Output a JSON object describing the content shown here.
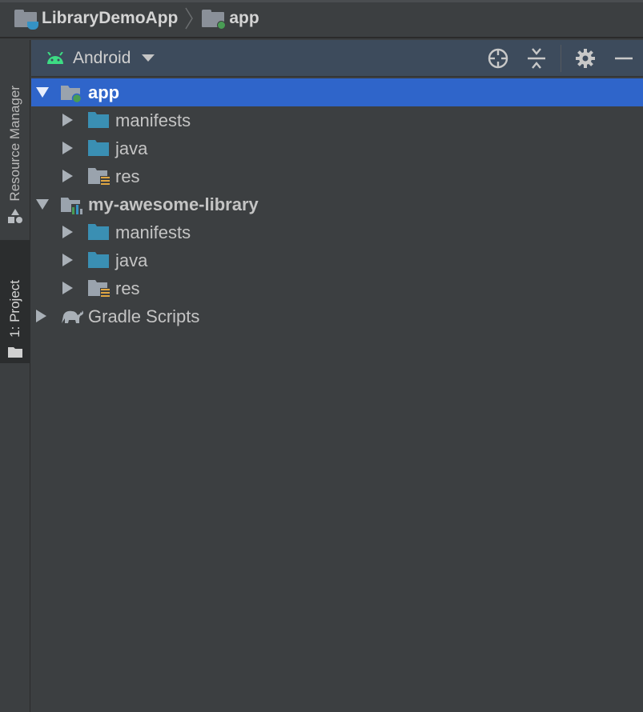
{
  "breadcrumb": {
    "project": "LibraryDemoApp",
    "module": "app"
  },
  "side_tabs": {
    "resource_manager": "Resource Manager",
    "project": "1: Project"
  },
  "tool_window": {
    "view_mode": "Android"
  },
  "tree": {
    "app": "app",
    "app_manifests": "manifests",
    "app_java": "java",
    "app_res": "res",
    "library": "my-awesome-library",
    "lib_manifests": "manifests",
    "lib_java": "java",
    "lib_res": "res",
    "gradle": "Gradle Scripts"
  },
  "colors": {
    "selection": "#2f65ca",
    "header": "#3d4b5c",
    "folder_blue": "#3a8fb3",
    "android_green": "#3ddc84"
  }
}
